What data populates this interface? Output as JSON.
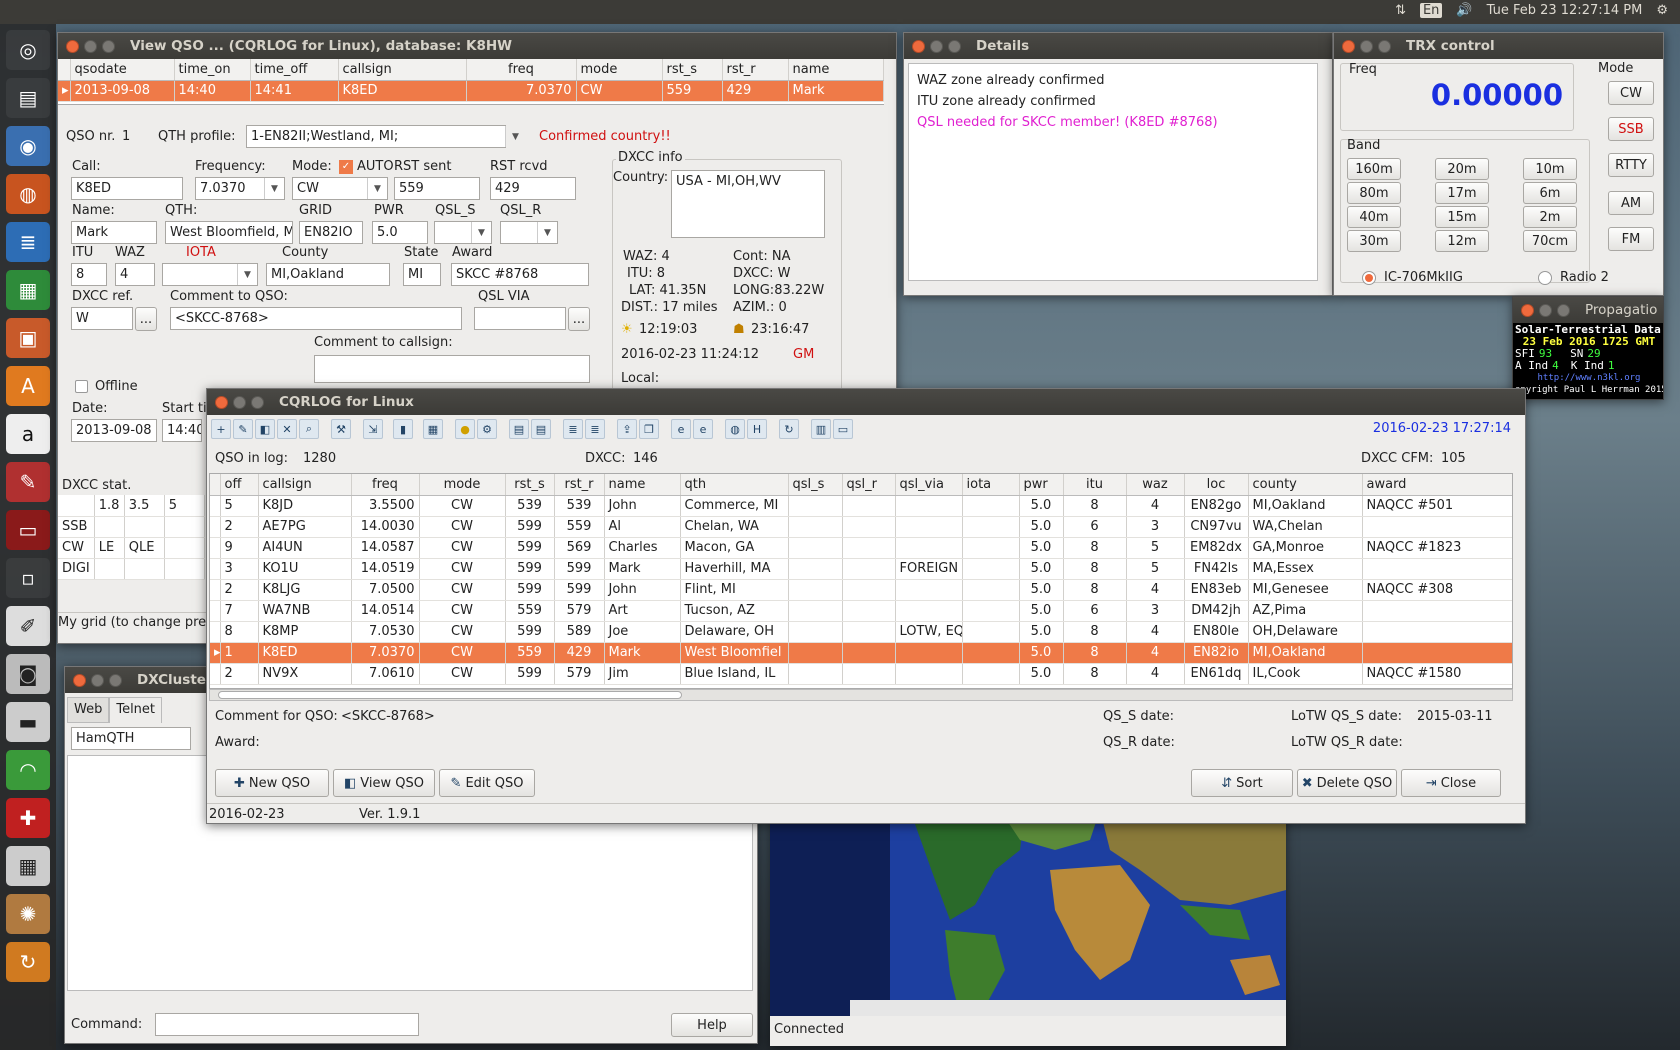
{
  "topbar": {
    "lang": "En",
    "clock": "Tue Feb 23 12:27:14 PM"
  },
  "launcher": {
    "icons": [
      "dash-icon",
      "files-icon",
      "chromium-icon",
      "firefox-icon",
      "writer-icon",
      "calc-icon",
      "impress-icon",
      "software-center-icon",
      "amazon-icon",
      "settings-icon",
      "terminal-icon",
      "workspace-icon",
      "editor-icon",
      "camera-icon",
      "scanner-icon",
      "rss-icon",
      "bible-icon",
      "calculator-icon",
      "cqrlog-icon",
      "update-icon"
    ]
  },
  "view_qso": {
    "title": "View QSO ... (CQRLOG for Linux), database: K8HW",
    "columns": [
      "qsodate",
      "time_on",
      "time_off",
      "callsign",
      "freq",
      "mode",
      "rst_s",
      "rst_r",
      "name"
    ],
    "row": [
      "2013-09-08",
      "14:40",
      "14:41",
      "K8ED",
      "7.0370",
      "CW",
      "559",
      "429",
      "Mark"
    ],
    "qso_nr_label": "QSO nr.",
    "qso_nr": "1",
    "qth_profile_label": "QTH profile:",
    "qth_profile": "1-EN82II;Westland, MI;",
    "confirmed": "Confirmed country!!",
    "call_label": "Call:",
    "call": "K8ED",
    "freq_label": "Frequency:",
    "freq": "7.0370",
    "mode_label": "Mode:",
    "auto_label": "AUTO",
    "mode": "CW",
    "rst_sent_label": "RST sent",
    "rst_sent": "559",
    "rst_rcvd_label": "RST rcvd",
    "rst_rcvd": "429",
    "name_label": "Name:",
    "name": "Mark",
    "qth_label": "QTH:",
    "qth": "West Bloomfield, M",
    "grid_label": "GRID",
    "grid": "EN82IO",
    "pwr_label": "PWR",
    "pwr": "5.0",
    "qsl_s_label": "QSL_S",
    "qsl_r_label": "QSL_R",
    "itu_label": "ITU",
    "itu": "8",
    "waz_label": "WAZ",
    "waz": "4",
    "iota_label": "IOTA",
    "county_label": "County",
    "county": "MI,Oakland",
    "state_label": "State",
    "state": "MI",
    "award_label": "Award",
    "award": "SKCC #8768",
    "dxcc_ref_label": "DXCC ref.",
    "dxcc_ref": "W",
    "comment_qso_label": "Comment to QSO:",
    "comment_qso": "<SKCC-8768>",
    "qsl_via_label": "QSL VIA",
    "comment_call_label": "Comment to callsign:",
    "offline_label": "Offline",
    "date_label": "Date:",
    "date": "2013-09-08",
    "start_label": "Start ti",
    "start": "14:40",
    "dxcc_info": {
      "label": "DXCC info",
      "country_label": "Country:",
      "country": "USA - MI,OH,WV",
      "waz": "WAZ: 4",
      "cont": "Cont:  NA",
      "itu": "ITU: 8",
      "dxcc": "DXCC: W",
      "lat": "LAT: 41.35N",
      "long": "LONG:83.22W",
      "dist": "DIST.: 17 miles",
      "azim": "AZIM.: 0",
      "sunrise": "12:19:03",
      "sunset": "23:16:47",
      "datetime": "2016-02-23  11:24:12",
      "gm": "GM",
      "local": "Local:"
    },
    "dxcc_stat": {
      "label": "DXCC stat.",
      "bands": [
        "1.8",
        "3.5",
        "5"
      ],
      "rows": [
        [
          "SSB",
          "",
          ""
        ],
        [
          "CW",
          "LE",
          "QLE"
        ],
        [
          "DIGI",
          "",
          ""
        ]
      ]
    },
    "mygrid": "My grid (to change pre"
  },
  "details": {
    "title": "Details",
    "lines": [
      "WAZ zone already confirmed",
      "ITU zone already confirmed",
      "QSL needed for SKCC member! (K8ED #8768)"
    ]
  },
  "trx": {
    "title": "TRX control",
    "freq_label": "Freq",
    "freq": "0.00000",
    "mode_label": "Mode",
    "band_label": "Band",
    "bands": [
      "160m",
      "20m",
      "10m",
      "80m",
      "17m",
      "6m",
      "40m",
      "15m",
      "2m",
      "30m",
      "12m",
      "70cm"
    ],
    "modes": [
      "CW",
      "SSB",
      "RTTY",
      "AM",
      "FM"
    ],
    "radio1": "IC-706MkIIG",
    "radio2": "Radio 2"
  },
  "propagation": {
    "title": "Propagatio",
    "heading": "Solar-Terrestrial Data",
    "date": "23 Feb 2016 1725 GMT",
    "sfi_label": "SFI",
    "sfi": "93",
    "sn_label": "SN",
    "sn": "29",
    "a_label": "A Ind",
    "a": "4",
    "k_label": "K Ind",
    "k": "1",
    "url": "http://www.n3kl.org",
    "copyright": "opyright Paul L Herrman 2015"
  },
  "dxcluster": {
    "title": "DXCluster",
    "tabs": [
      "Web",
      "Telnet"
    ],
    "server": "HamQTH",
    "command_label": "Command:",
    "help": "Help"
  },
  "map": {
    "status": "Connected"
  },
  "cqrlog": {
    "title": "CQRLOG for Linux",
    "datetime": "2016-02-23 17:27:14",
    "qso_in_log_label": "QSO in log:",
    "qso_in_log": "1280",
    "dxcc_label": "DXCC:",
    "dxcc": "146",
    "dxcc_cfm_label": "DXCC CFM:",
    "dxcc_cfm": "105",
    "columns": [
      "off",
      "callsign",
      "freq",
      "mode",
      "rst_s",
      "rst_r",
      "name",
      "qth",
      "qsl_s",
      "qsl_r",
      "qsl_via",
      "iota",
      "pwr",
      "itu",
      "waz",
      "loc",
      "county",
      "award"
    ],
    "rows": [
      [
        "5",
        "K8JD",
        "3.5500",
        "CW",
        "539",
        "539",
        "John",
        "Commerce, MI",
        "",
        "",
        "",
        "",
        "5.0",
        "8",
        "4",
        "EN82go",
        "MI,Oakland",
        "NAQCC #501"
      ],
      [
        "2",
        "AE7PG",
        "14.0030",
        "CW",
        "599",
        "559",
        "Al",
        "Chelan, WA",
        "",
        "",
        "",
        "",
        "5.0",
        "6",
        "3",
        "CN97vu",
        "WA,Chelan",
        ""
      ],
      [
        "9",
        "AI4UN",
        "14.0587",
        "CW",
        "599",
        "569",
        "Charles",
        "Macon, GA",
        "",
        "",
        "",
        "",
        "5.0",
        "8",
        "5",
        "EM82dx",
        "GA,Monroe",
        "NAQCC #1823"
      ],
      [
        "3",
        "KO1U",
        "14.0519",
        "CW",
        "599",
        "599",
        "Mark",
        "Haverhill, MA",
        "",
        "",
        "FOREIGN",
        "",
        "5.0",
        "8",
        "5",
        "FN42ls",
        "MA,Essex",
        ""
      ],
      [
        "2",
        "K8LJG",
        "7.0500",
        "CW",
        "599",
        "599",
        "John",
        "Flint, MI",
        "",
        "",
        "",
        "",
        "5.0",
        "8",
        "4",
        "EN83eb",
        "MI,Genesee",
        "NAQCC #308"
      ],
      [
        "7",
        "WA7NB",
        "14.0514",
        "CW",
        "559",
        "579",
        "Art",
        "Tucson, AZ",
        "",
        "",
        "",
        "",
        "5.0",
        "6",
        "3",
        "DM42jh",
        "AZ,Pima",
        ""
      ],
      [
        "8",
        "K8MP",
        "7.0530",
        "CW",
        "599",
        "589",
        "Joe",
        "Delaware, OH",
        "",
        "",
        "LOTW, EQ",
        "",
        "5.0",
        "8",
        "4",
        "EN80le",
        "OH,Delaware",
        ""
      ],
      [
        "1",
        "K8ED",
        "7.0370",
        "CW",
        "559",
        "429",
        "Mark",
        "West Bloomfiel",
        "",
        "",
        "",
        "",
        "5.0",
        "8",
        "4",
        "EN82io",
        "MI,Oakland",
        ""
      ],
      [
        "2",
        "NV9X",
        "7.0610",
        "CW",
        "599",
        "579",
        "Jim",
        "Blue Island, IL",
        "",
        "",
        "",
        "",
        "5.0",
        "8",
        "4",
        "EN61dq",
        "IL,Cook",
        "NAQCC #1580"
      ]
    ],
    "comment_label": "Comment for QSO:",
    "comment": "<SKCC-8768>",
    "award_label": "Award:",
    "qs_s_label": "QS_S date:",
    "qs_r_label": "QS_R date:",
    "lotw_s_label": "LoTW QS_S date:",
    "lotw_s": "2015-03-11",
    "lotw_r_label": "LoTW QS_R date:",
    "buttons": {
      "new": "New QSO",
      "view": "View QSO",
      "edit": "Edit QSO",
      "sort": "Sort",
      "delete": "Delete QSO",
      "close": "Close"
    },
    "status_date": "2016-02-23",
    "version": "Ver. 1.9.1"
  }
}
